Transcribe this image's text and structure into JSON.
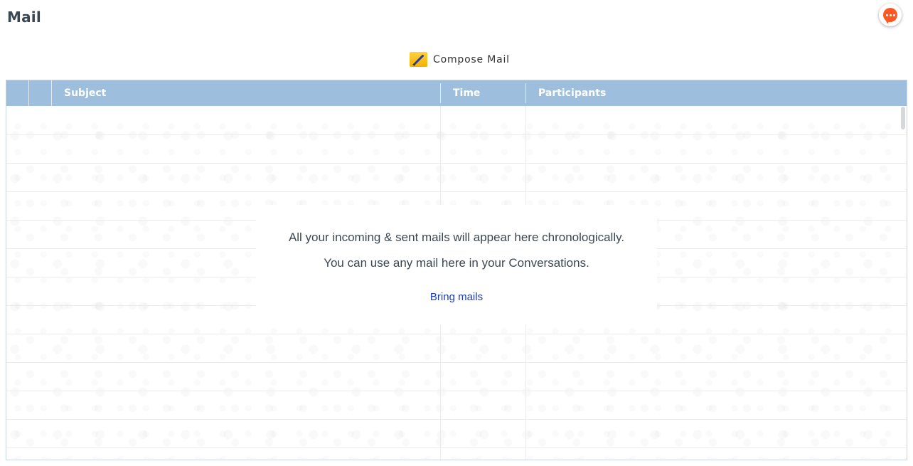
{
  "header": {
    "title": "Mail"
  },
  "chat_button": {
    "icon": "chat-bubble-icon",
    "color": "#ff5722"
  },
  "toolbar": {
    "compose_label": "Compose Mail",
    "compose_icon": "pencil-icon"
  },
  "grid": {
    "header_color": "#9dbfdd",
    "columns": [
      "",
      "",
      "Subject",
      "Time",
      "Participants"
    ],
    "rows": []
  },
  "empty_state": {
    "line1": "All your incoming & sent mails will appear here chronologically.",
    "line2": "You can use any mail here in your Conversations.",
    "action_label": "Bring mails",
    "link_color": "#1a3cb8"
  }
}
